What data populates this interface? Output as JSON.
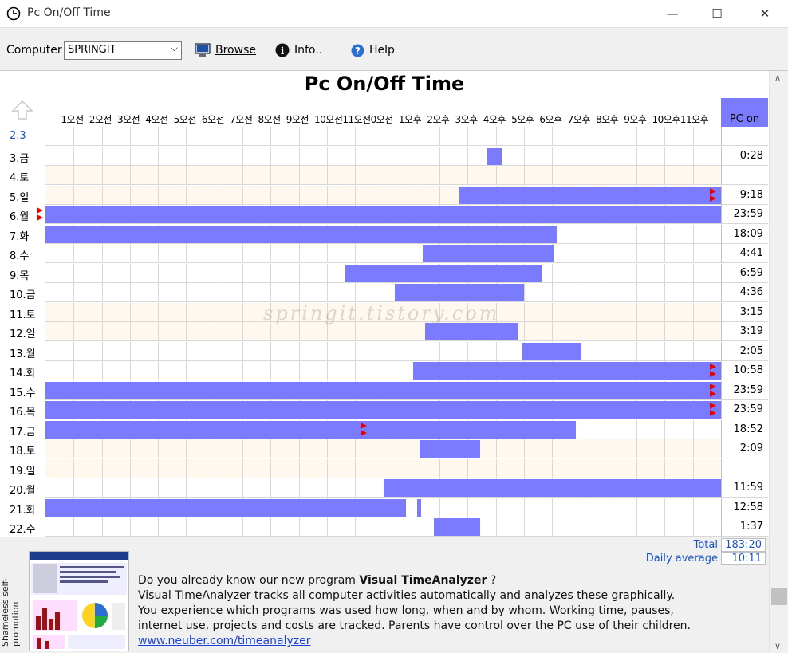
{
  "window": {
    "title": "Pc On/Off Time",
    "minimize": "—",
    "maximize": "☐",
    "close": "✕"
  },
  "toolbar": {
    "computer_label": "Computer",
    "computer_value": "SPRINGIT",
    "browse_label": "Browse",
    "info_label": "Info..",
    "help_label": "Help"
  },
  "chart": {
    "title": "Pc On/Off Time",
    "pcon_header": "PC on",
    "watermark": "springit.tistory.com",
    "hours": [
      "1오전",
      "2오전",
      "3오전",
      "4오전",
      "5오전",
      "6오전",
      "7오전",
      "8오전",
      "9오전",
      "10오전",
      "11오전",
      "0오전",
      "1오후",
      "2오후",
      "3오후",
      "4오후",
      "5오후",
      "6오후",
      "7오후",
      "8오후",
      "9오후",
      "10오후",
      "11오후"
    ]
  },
  "chart_data": {
    "type": "gantt",
    "title": "Pc On/Off Time",
    "x_range_hours": [
      0,
      24
    ],
    "days": [
      {
        "label": "2.3",
        "pcon": "",
        "weekend": false,
        "blue": true,
        "bars": [],
        "markers": []
      },
      {
        "label": "3.금",
        "pcon": "0:28",
        "weekend": false,
        "bars": [
          [
            15.7,
            16.2
          ]
        ],
        "markers": []
      },
      {
        "label": "4.토",
        "pcon": "",
        "weekend": true,
        "bars": [],
        "markers": []
      },
      {
        "label": "5.일",
        "pcon": "9:18",
        "weekend": true,
        "bars": [
          [
            14.7,
            24.0
          ]
        ],
        "markers": [
          {
            "h": 23.6,
            "double": true
          }
        ]
      },
      {
        "label": "6.월",
        "pcon": "23:59",
        "weekend": false,
        "bars": [
          [
            0.0,
            24.0
          ]
        ],
        "markers": [
          {
            "h": -0.3,
            "double": true
          }
        ]
      },
      {
        "label": "7.화",
        "pcon": "18:09",
        "weekend": false,
        "bars": [
          [
            0.0,
            18.15
          ]
        ],
        "markers": []
      },
      {
        "label": "8.수",
        "pcon": "4:41",
        "weekend": false,
        "bars": [
          [
            13.4,
            18.05
          ]
        ],
        "markers": []
      },
      {
        "label": "9.목",
        "pcon": "6:59",
        "weekend": false,
        "bars": [
          [
            10.65,
            17.65
          ]
        ],
        "markers": []
      },
      {
        "label": "10.금",
        "pcon": "4:36",
        "weekend": false,
        "bars": [
          [
            12.4,
            17.0
          ]
        ],
        "markers": []
      },
      {
        "label": "11.토",
        "pcon": "3:15",
        "weekend": true,
        "bars": [],
        "markers": []
      },
      {
        "label": "12.일",
        "pcon": "3:19",
        "weekend": true,
        "bars": [
          [
            13.5,
            16.8
          ]
        ],
        "markers": []
      },
      {
        "label": "13.월",
        "pcon": "2:05",
        "weekend": false,
        "bars": [
          [
            16.95,
            19.05
          ]
        ],
        "markers": []
      },
      {
        "label": "14.화",
        "pcon": "10:58",
        "weekend": false,
        "bars": [
          [
            13.05,
            24.0
          ]
        ],
        "markers": [
          {
            "h": 23.6,
            "double": true
          }
        ]
      },
      {
        "label": "15.수",
        "pcon": "23:59",
        "weekend": false,
        "bars": [
          [
            0.0,
            24.0
          ]
        ],
        "markers": [
          {
            "h": 23.6,
            "double": true
          }
        ]
      },
      {
        "label": "16.목",
        "pcon": "23:59",
        "weekend": false,
        "bars": [
          [
            0.0,
            24.0
          ]
        ],
        "markers": [
          {
            "h": 23.6,
            "double": true
          }
        ]
      },
      {
        "label": "17.금",
        "pcon": "18:52",
        "weekend": false,
        "bars": [
          [
            0.0,
            18.85
          ]
        ],
        "markers": [
          {
            "h": 11.2,
            "double": true
          }
        ]
      },
      {
        "label": "18.토",
        "pcon": "2:09",
        "weekend": true,
        "bars": [
          [
            13.3,
            15.45
          ]
        ],
        "markers": []
      },
      {
        "label": "19.일",
        "pcon": "",
        "weekend": true,
        "bars": [],
        "markers": []
      },
      {
        "label": "20.월",
        "pcon": "11:59",
        "weekend": false,
        "bars": [
          [
            12.0,
            24.0
          ]
        ],
        "markers": []
      },
      {
        "label": "21.화",
        "pcon": "12:58",
        "weekend": false,
        "bars": [
          [
            0.0,
            12.8
          ],
          [
            13.2,
            13.35
          ]
        ],
        "markers": []
      },
      {
        "label": "22.수",
        "pcon": "1:37",
        "weekend": false,
        "bars": [
          [
            13.8,
            15.45
          ]
        ],
        "markers": []
      }
    ]
  },
  "totals": {
    "total_label": "Total",
    "total_value": "183:20",
    "avg_label": "Daily average",
    "avg_value": "10:11"
  },
  "promo": {
    "side_label": "Shameless self-promotion",
    "lead": "Do you already know our new program ",
    "product": "Visual TimeAnalyzer",
    "lead_end": " ?",
    "line2": "Visual TimeAnalyzer tracks all computer activities automatically and analyzes these graphically.",
    "line3": "You experience which programs was used how long, when and by whom. Working time, pauses,",
    "line4": "internet use, projects and costs are tracked. Parents have control over the PC use of their children.",
    "link": "www.neuber.com/timeanalyzer"
  },
  "colors": {
    "bar": "#7b7bff",
    "marker": "#e80000",
    "weekend": "#fff8ee",
    "link": "#1a40d8"
  }
}
